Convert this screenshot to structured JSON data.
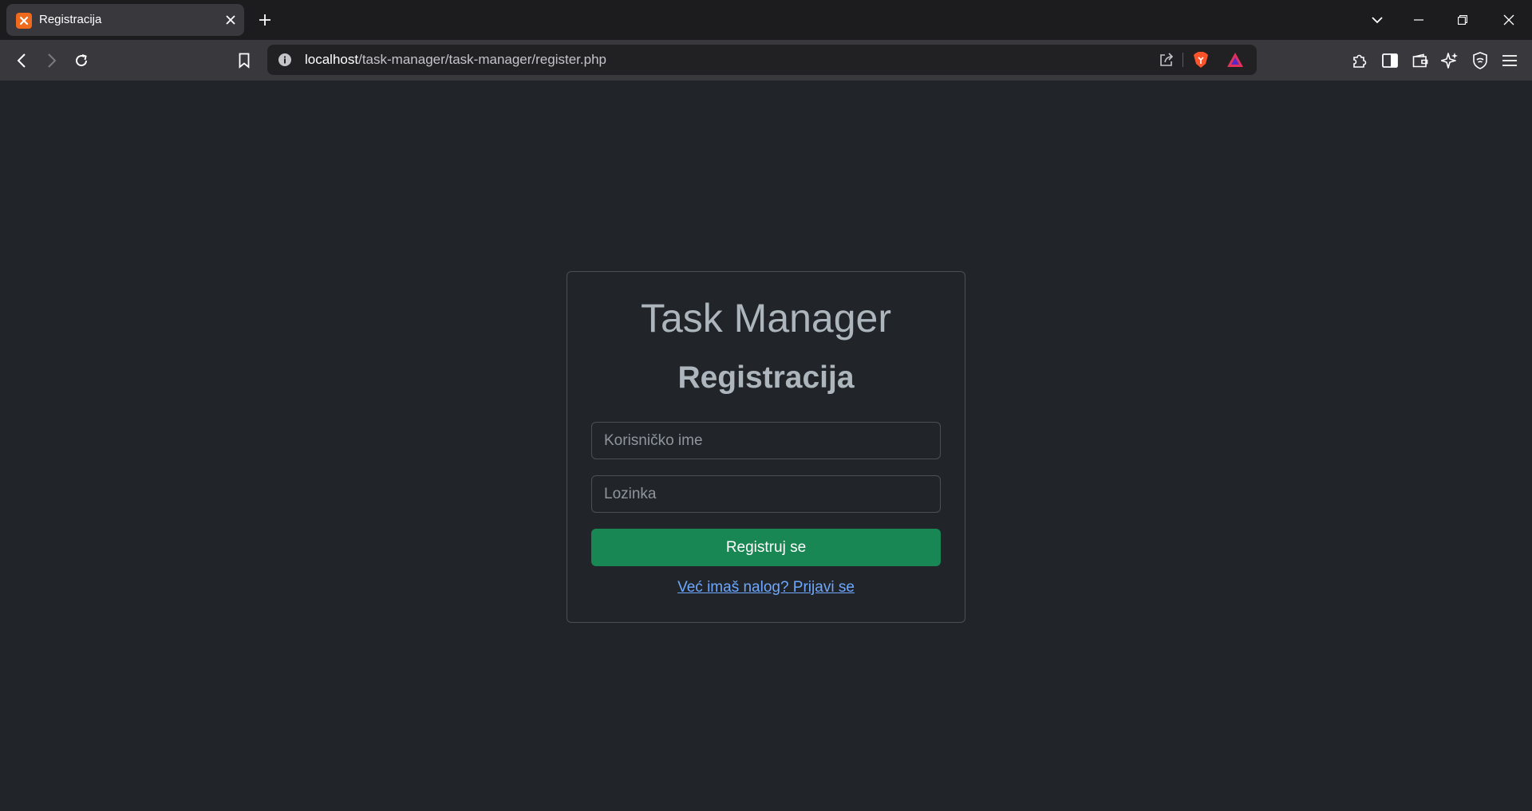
{
  "browser": {
    "tab": {
      "title": "Registracija",
      "favicon": "xampp-logo-icon"
    },
    "url": {
      "host": "localhost",
      "path": "/task-manager/task-manager/register.php"
    },
    "icons": {
      "back": "back-arrow-icon",
      "forward": "forward-arrow-icon",
      "reload": "reload-icon",
      "bookmark": "bookmark-icon",
      "site_info": "info-icon",
      "share": "share-icon",
      "brave_shields": "brave-shields-icon",
      "brave_rewards": "brave-rewards-icon",
      "extensions": "extensions-icon",
      "sidebar": "sidebar-icon",
      "wallet": "wallet-icon",
      "leo": "leo-ai-icon",
      "vpn": "vpn-icon",
      "menu": "menu-icon"
    }
  },
  "page": {
    "app_title": "Task Manager",
    "form_title": "Registracija",
    "username_placeholder": "Korisničko ime",
    "password_placeholder": "Lozinka",
    "submit_label": "Registruj se",
    "login_link": "Već imaš nalog? Prijavi se"
  },
  "colors": {
    "page_bg": "#212529",
    "submit_bg": "#198754",
    "link": "#6ea8fe",
    "title_text": "#adb5bd"
  }
}
